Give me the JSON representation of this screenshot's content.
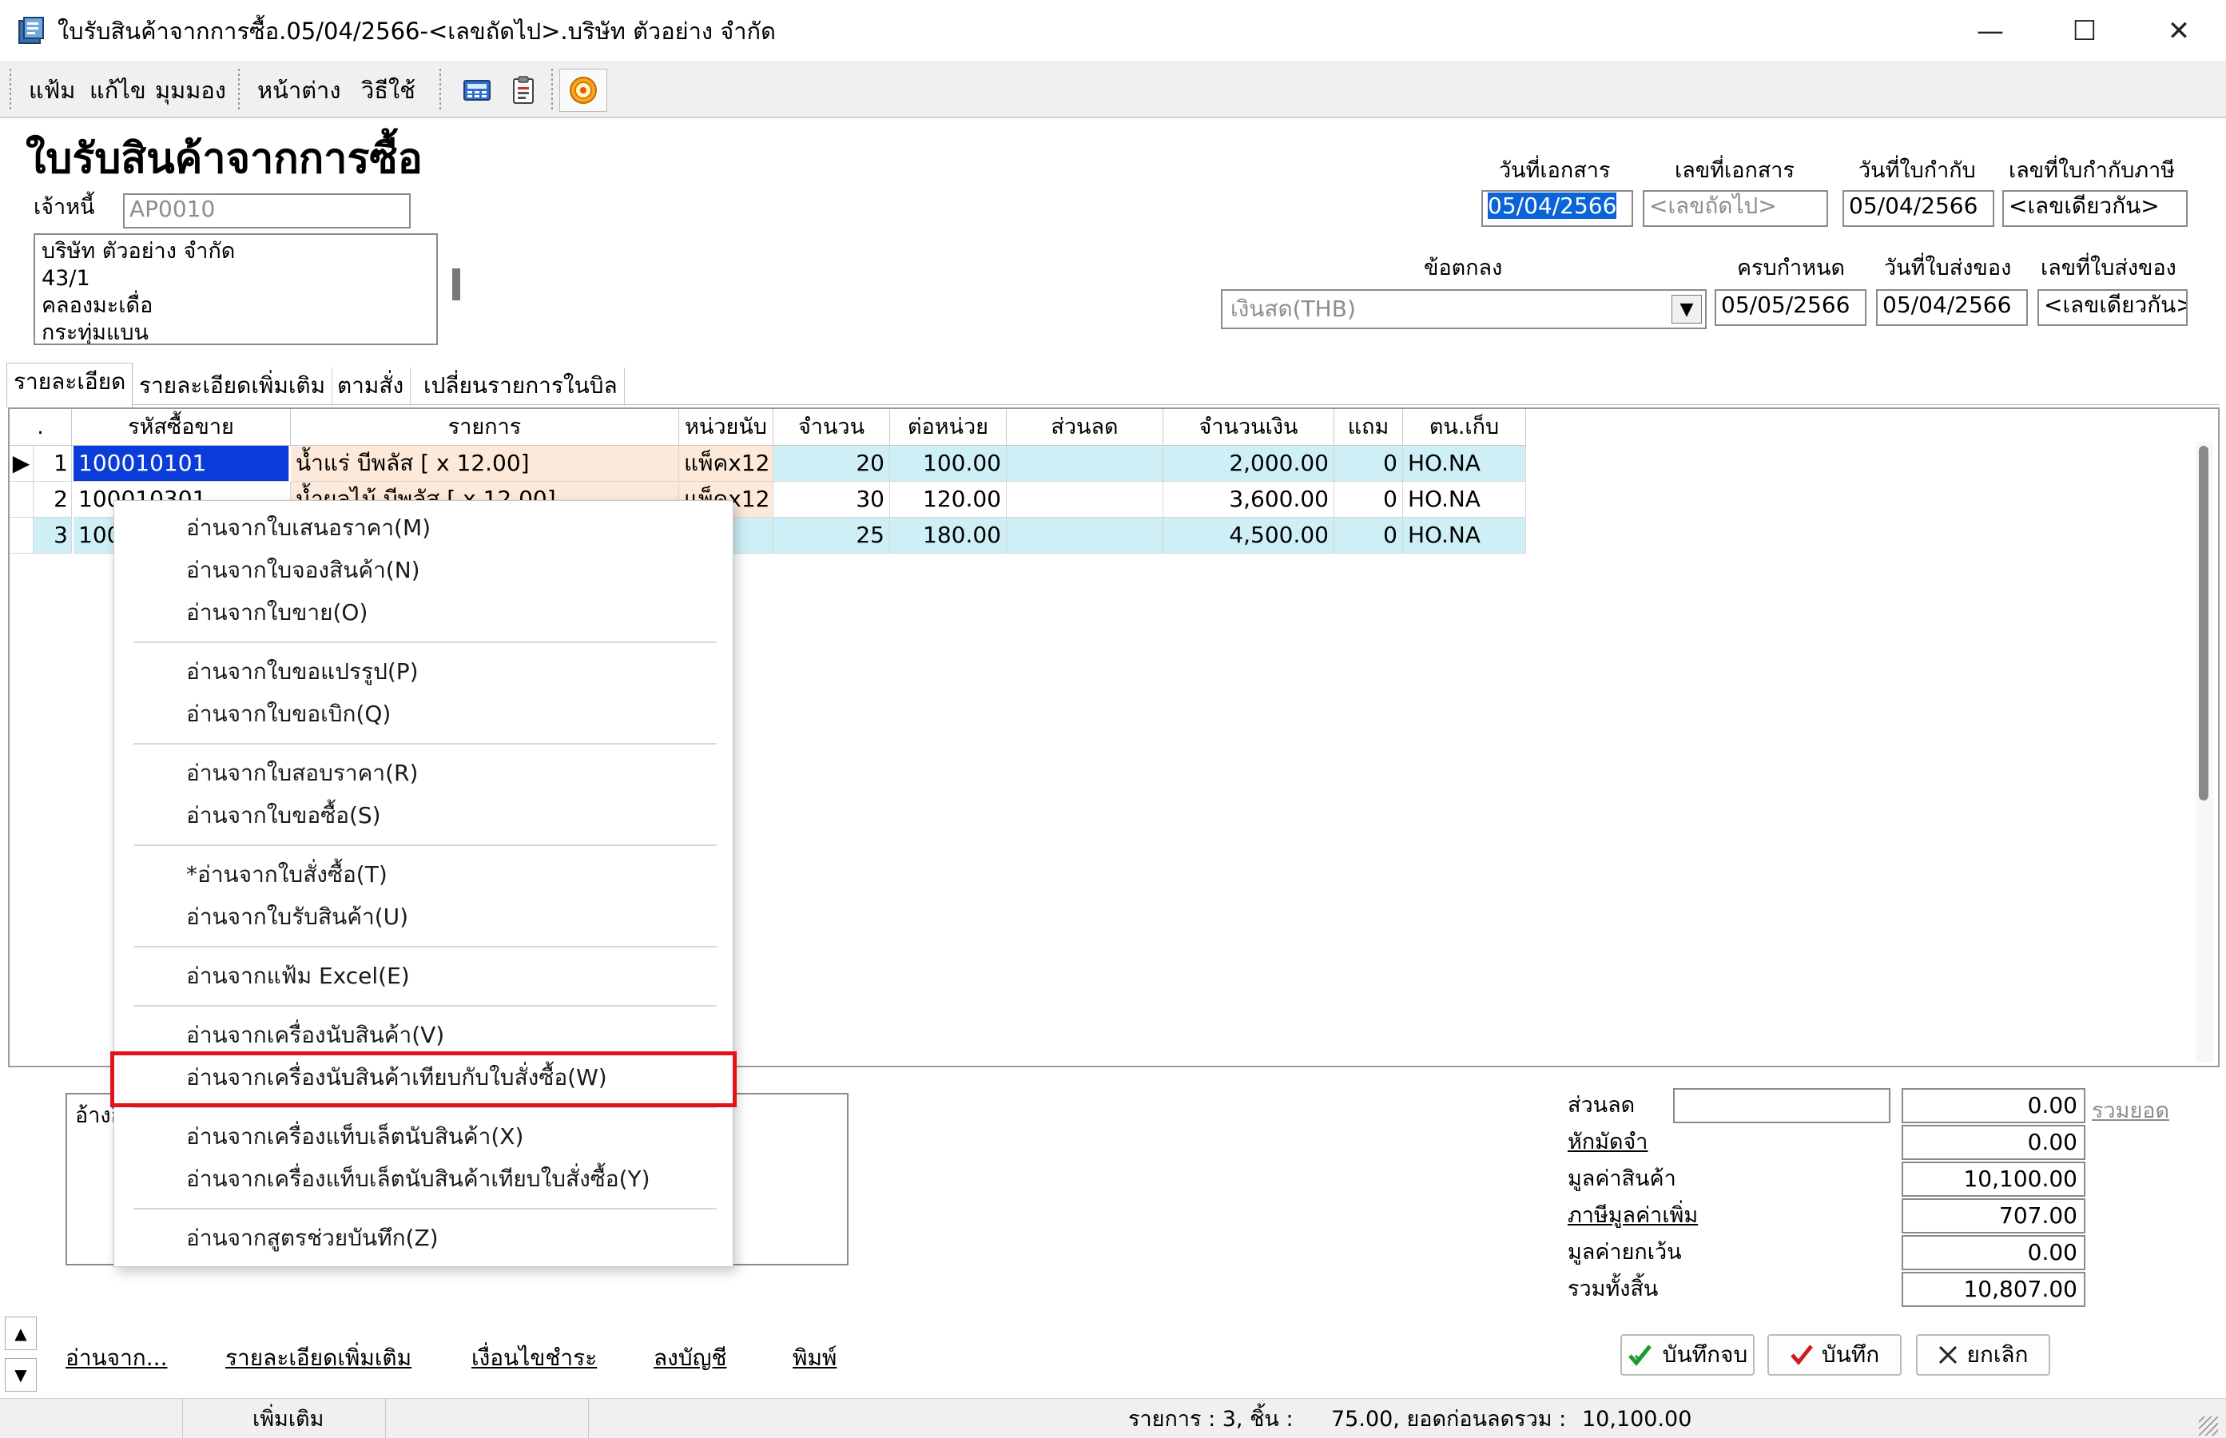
{
  "window": {
    "title": "ใบรับสินค้าจากการซื้อ.05/04/2566-<เลขถัดไป>.บริษัท ตัวอย่าง จำกัด",
    "minimize": "—",
    "maximize": "☐",
    "close": "✕"
  },
  "menu": {
    "file": "แฟ้ม",
    "edit": "แก้ไข",
    "view": "มุมมอง",
    "window": "หน้าต่าง",
    "help": "วิธีใช้"
  },
  "header": {
    "form_title": "ใบรับสินค้าจากการซื้อ",
    "creditor_label": "เจ้าหนี้",
    "creditor_code": "AP0010",
    "address_lines": [
      "บริษัท ตัวอย่าง จำกัด",
      "43/1",
      "คลองมะเดื่อ",
      "กระทุ่มแบน"
    ],
    "doc_date_label": "วันที่เอกสาร",
    "doc_date": "05/04/2566",
    "doc_no_label": "เลขที่เอกสาร",
    "doc_no": "<เลขถัดไป>",
    "tax_date_label": "วันที่ใบกำกับ",
    "tax_date": "05/04/2566",
    "tax_no_label": "เลขที่ใบกำกับภาษี",
    "tax_no": "<เลขเดียวกัน>",
    "terms_label": "ข้อตกลง",
    "terms_value": "เงินสด(THB)",
    "due_label": "ครบกำหนด",
    "due_date": "05/05/2566",
    "delivery_date_label": "วันที่ใบส่งของ",
    "delivery_date": "05/04/2566",
    "delivery_no_label": "เลขที่ใบส่งของ",
    "delivery_no": "<เลขเดียวกัน>"
  },
  "tabs": [
    "รายละเอียด",
    "รายละเอียดเพิ่มเติม",
    "ตามสั่ง",
    "เปลี่ยนรายการในบิล"
  ],
  "grid": {
    "columns": [
      ".",
      "รหัสซื้อขาย",
      "รายการ",
      "หน่วยนับ",
      "จำนวน",
      "ต่อหน่วย",
      "ส่วนลด",
      "จำนวนเงิน",
      "แถม",
      "ตน.เก็บ"
    ],
    "rows": [
      {
        "marker": "▶",
        "no": "1",
        "code": "100010101",
        "desc": "น้ำแร่ บีพลัส [ x 12.00]",
        "unit": "แพ็คx12",
        "qty": "20",
        "price": "100.00",
        "discount": "",
        "amount": "2,000.00",
        "free": "0",
        "loc": "HO.NA"
      },
      {
        "marker": "",
        "no": "2",
        "code": "100010301",
        "desc": "น้ำผลไม้ บีพลัส [ x 12.00]",
        "unit": "แพ็คx12",
        "qty": "30",
        "price": "120.00",
        "discount": "",
        "amount": "3,600.00",
        "free": "0",
        "loc": "HO.NA"
      },
      {
        "marker": "",
        "no": "3",
        "code": "100",
        "desc": "",
        "unit": "x12",
        "qty": "25",
        "price": "180.00",
        "discount": "",
        "amount": "4,500.00",
        "free": "0",
        "loc": "HO.NA"
      }
    ]
  },
  "context_menu": {
    "items": [
      "อ่านจากใบเสนอราคา(M)",
      "อ่านจากใบจองสินค้า(N)",
      "อ่านจากใบขาย(O)",
      "อ่านจากใบขอแปรรูป(P)",
      "อ่านจากใบขอเบิก(Q)",
      "อ่านจากใบสอบราคา(R)",
      "อ่านจากใบขอซื้อ(S)",
      "*อ่านจากใบสั่งซื้อ(T)",
      "อ่านจากใบรับสินค้า(U)",
      "อ่านจากแฟ้ม Excel(E)",
      "อ่านจากเครื่องนับสินค้า(V)",
      "อ่านจากเครื่องนับสินค้าเทียบกับใบสั่งซื้อ(W)",
      "อ่านจากเครื่องแท็บเล็ตนับสินค้า(X)",
      "อ่านจากเครื่องแท็บเล็ตนับสินค้าเทียบใบสั่งซื้อ(Y)",
      "อ่านจากสูตรช่วยบันทึก(Z)"
    ],
    "highlighted_index": 11,
    "highlight_color": "#e3121a"
  },
  "remark": {
    "label": "อ้างอิง"
  },
  "totals": {
    "discount_label": "ส่วนลด",
    "discount_value": "0.00",
    "sum_link": "รวมยอด",
    "deposit_label": "หักมัดจำ",
    "deposit_value": "0.00",
    "goods_value_label": "มูลค่าสินค้า",
    "goods_value": "10,100.00",
    "vat_label": "ภาษีมูลค่าเพิ่ม",
    "vat_value": "707.00",
    "exempt_label": "มูลค่ายกเว้น",
    "exempt_value": "0.00",
    "grand_total_label": "รวมทั้งสิ้น",
    "grand_total": "10,807.00"
  },
  "bottom_links": [
    "อ่านจาก...",
    "รายละเอียดเพิ่มเติม",
    "เงื่อนไขชำระ",
    "ลงบัญชี",
    "พิมพ์"
  ],
  "buttons": {
    "save_close": "บันทึกจบ",
    "save": "บันทึก",
    "cancel": "ยกเลิก"
  },
  "status": {
    "mode": "เพิ่มเติม",
    "summary_prefix": "รายการ : 3, ชิ้น :",
    "pieces": "75.00, ยอดก่อนลดรวม :",
    "subtotal": "10,100.00"
  }
}
